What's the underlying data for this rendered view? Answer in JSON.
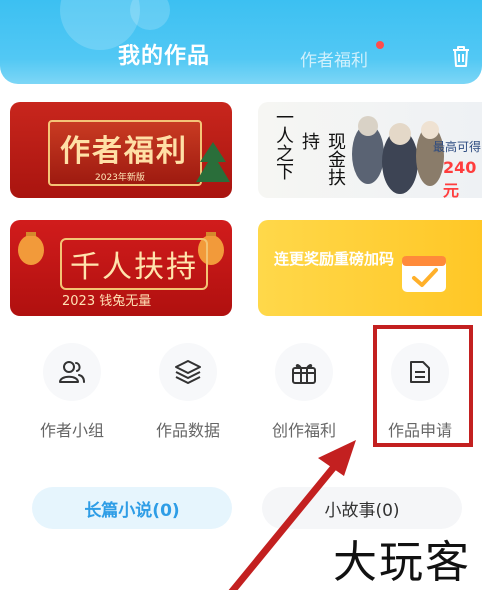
{
  "header": {
    "tab_active": "我的作品",
    "tab_inactive": "作者福利",
    "has_notification_dot": true
  },
  "banners": [
    {
      "title": "作者福利",
      "subtitle": "2023年新版"
    },
    {
      "vertical_text_1": "一人之下",
      "vertical_text_2": "现金扶持",
      "price_label": "最高可得",
      "price_value": "240元"
    },
    {
      "title": "千人扶持",
      "subtitle": "2023 钱兔无量"
    },
    {
      "title": "连更奖励重磅加码"
    }
  ],
  "quick_actions": [
    {
      "label": "作者小组",
      "icon": "group-icon"
    },
    {
      "label": "作品数据",
      "icon": "layers-icon"
    },
    {
      "label": "创作福利",
      "icon": "gift-icon"
    },
    {
      "label": "作品申请",
      "icon": "document-icon"
    }
  ],
  "tabs": {
    "long_novel": "长篇小说(0)",
    "short_story": "小故事(0)"
  },
  "watermark": "大玩客",
  "colors": {
    "header_blue": "#3cc0f2",
    "highlight_red": "#c32020",
    "accent_blue": "#2e9de6"
  }
}
